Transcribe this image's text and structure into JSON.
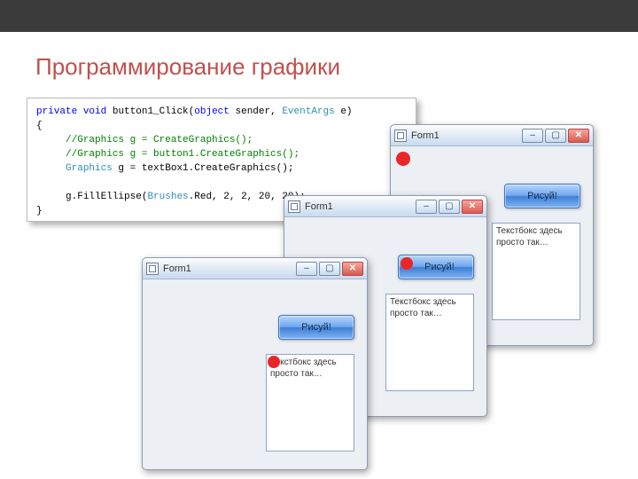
{
  "slide": {
    "title": "Программирование графики"
  },
  "code": {
    "private": "private",
    "void": "void",
    "method": "button1_Click",
    "open_paren": "(",
    "object": "object",
    "sender": " sender, ",
    "eventargs": "EventArgs",
    "e_param": " e)",
    "brace_open": "{",
    "c1": "//Graphics g = CreateGraphics();",
    "c2": "//Graphics g = button1.CreateGraphics();",
    "gline_type": "Graphics",
    "gline_rest": " g = textBox1.CreateGraphics();",
    "fill_pre": "g.FillEllipse(",
    "brushes": "Brushes",
    "fill_post": ".Red, 2, 2, 20, 20);",
    "brace_close": "}"
  },
  "windows": {
    "title": "Form1",
    "button_label": "Рисуй!",
    "textbox_text": "Текстбокс здесь просто так…",
    "min_glyph": "–",
    "max_glyph": "▢",
    "close_glyph": "✕"
  }
}
